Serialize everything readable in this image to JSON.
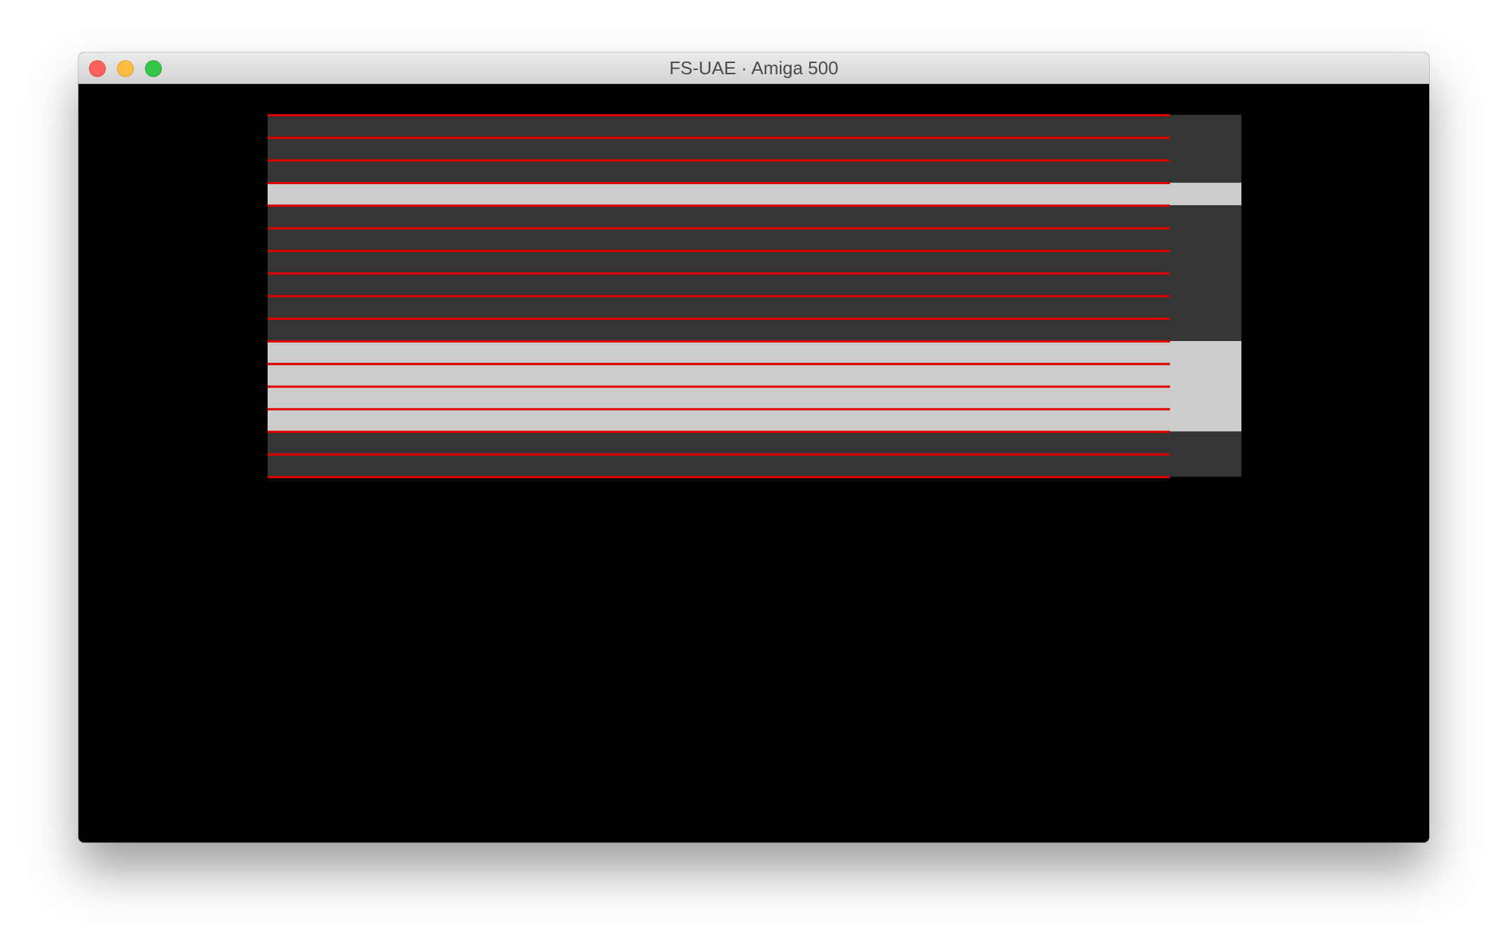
{
  "window": {
    "title": "FS-UAE · Amiga 500"
  },
  "icons": {
    "close": "close-button-icon",
    "minimize": "minimize-button-icon",
    "maximize": "zoom-button-icon"
  },
  "colors": {
    "display_background": "#000000",
    "band_dark": "#353535",
    "band_light": "#cccccc",
    "raster_line": "#e00000"
  },
  "screen": {
    "bands": [
      "dark",
      "light",
      "dark",
      "light",
      "dark"
    ],
    "band_rows": [
      3,
      1,
      6,
      4,
      2
    ],
    "raster_line_count": 17
  }
}
